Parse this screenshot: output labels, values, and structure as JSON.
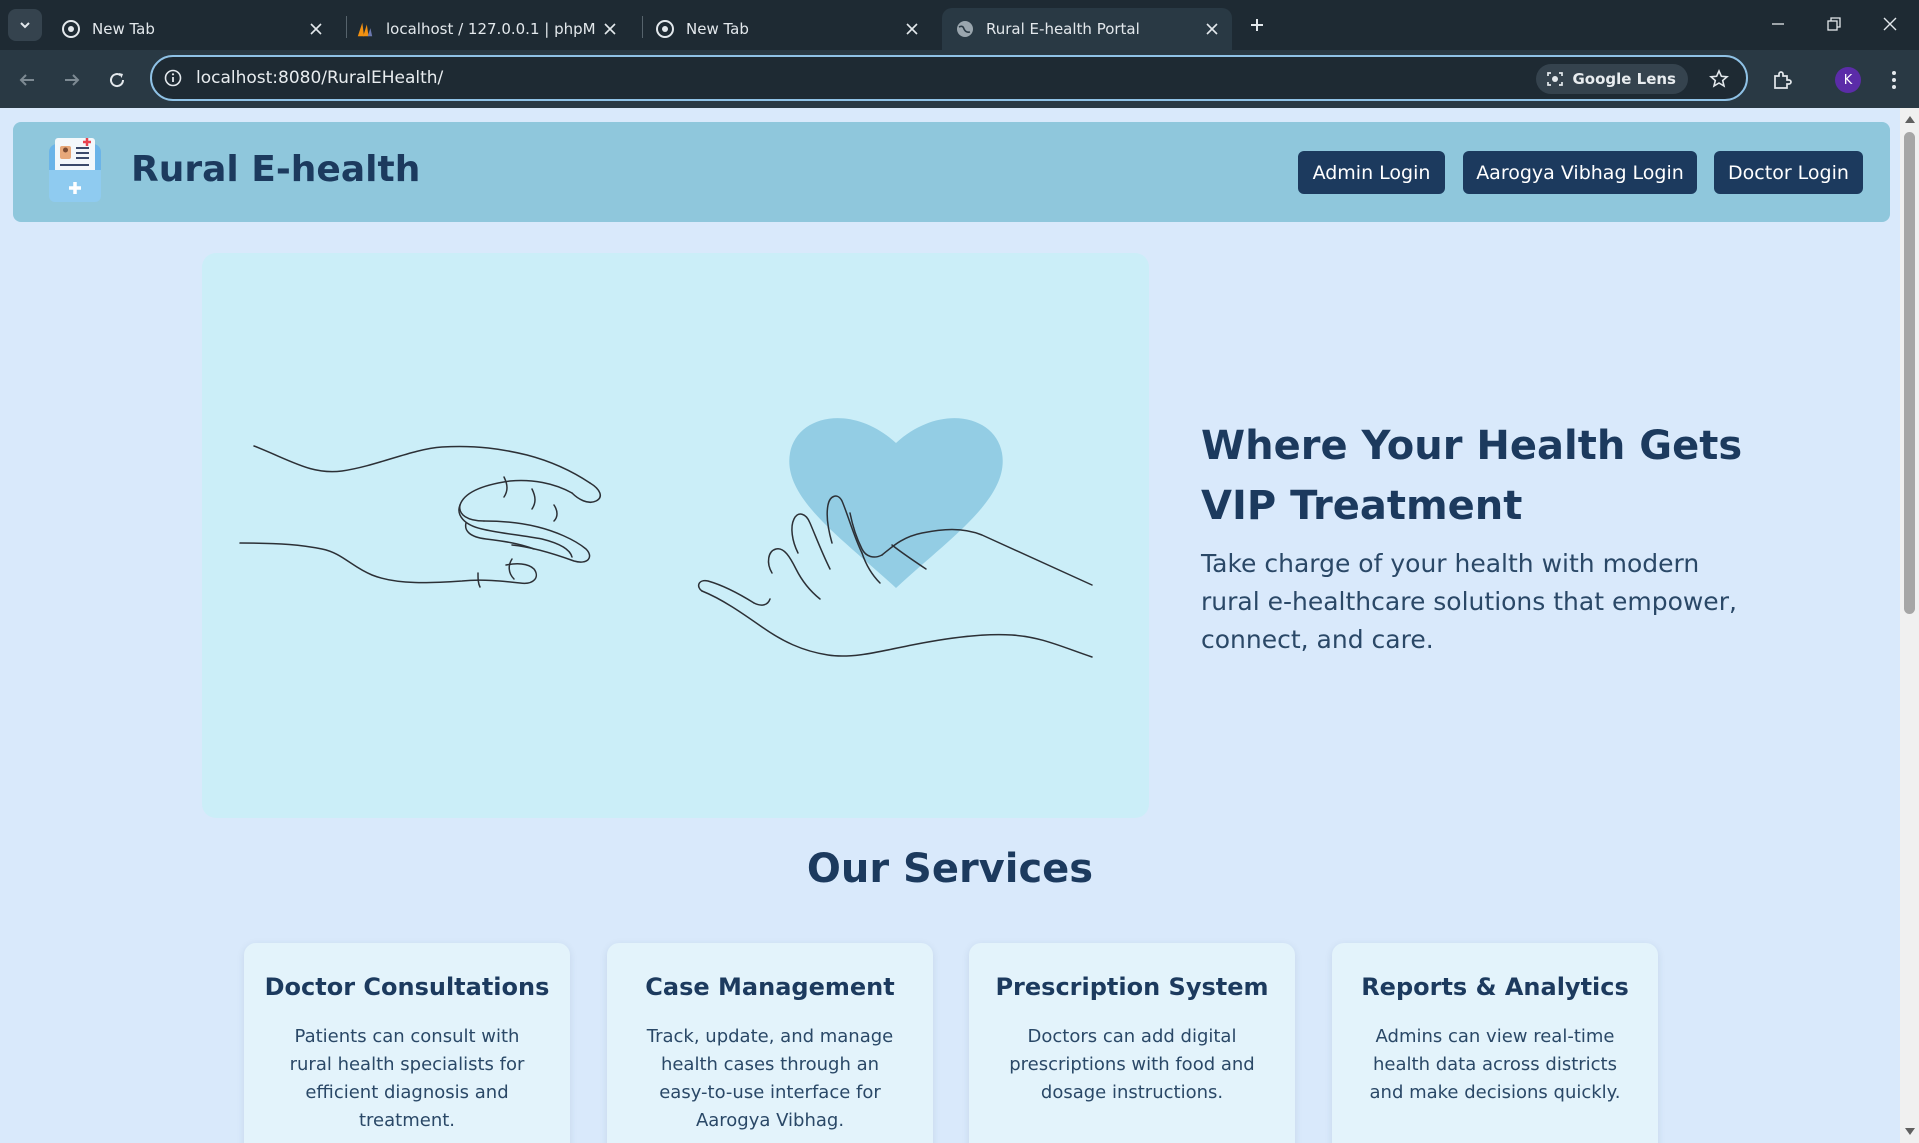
{
  "browser": {
    "tabs": [
      {
        "title": "New Tab",
        "favicon": "chrome-icon"
      },
      {
        "title": "localhost / 127.0.0.1 | phpMyAdmin",
        "favicon": "phpmyadmin-icon"
      },
      {
        "title": "New Tab",
        "favicon": "chrome-icon"
      },
      {
        "title": "Rural E-health Portal",
        "favicon": "globe-icon",
        "active": true
      }
    ],
    "url": "localhost:8080/RuralEHealth/",
    "lens_label": "Google Lens",
    "profile_initial": "K"
  },
  "header": {
    "brand": "Rural E-health",
    "buttons": {
      "admin": "Admin Login",
      "aarogya": "Aarogya Vibhag Login",
      "doctor": "Doctor Login"
    }
  },
  "hero": {
    "title": "Where Your Health Gets VIP Treatment",
    "subtitle": "Take charge of your health with modern rural e-healthcare solutions that empower, connect, and care."
  },
  "services": {
    "title": "Our Services",
    "cards": [
      {
        "title": "Doctor Consultations",
        "text": "Patients can consult with rural health specialists for efficient diagnosis and treatment."
      },
      {
        "title": "Case Management",
        "text": "Track, update, and manage health cases through an easy-to-use interface for Aarogya Vibhag."
      },
      {
        "title": "Prescription System",
        "text": "Doctors can add digital prescriptions with food and dosage instructions."
      },
      {
        "title": "Reports & Analytics",
        "text": "Admins can view real-time health data across districts and make decisions quickly."
      }
    ]
  },
  "colors": {
    "brand_dark": "#1c3a5e",
    "header_bg": "#8fc7dc",
    "page_bg": "#d9e9fb",
    "hero_bg": "#cbeef8",
    "heart": "#93cde4"
  }
}
